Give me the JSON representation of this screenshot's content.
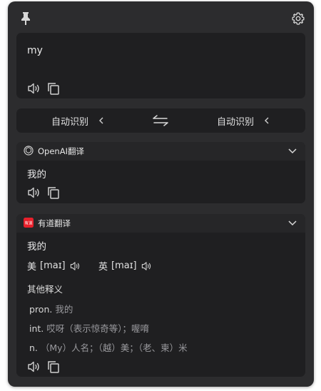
{
  "input": {
    "text": "my"
  },
  "languages": {
    "source": "自动识别",
    "target": "自动识别"
  },
  "openai": {
    "service_name": "OpenAI翻译",
    "result": "我的"
  },
  "youdao": {
    "service_name": "有道翻译",
    "logo_text": "有道",
    "result": "我的",
    "phonetics": [
      {
        "region": "美",
        "ipa": "[maɪ]"
      },
      {
        "region": "英",
        "ipa": "[maɪ]"
      }
    ],
    "other_label": "其他释义",
    "definitions": [
      {
        "pos": "pron.",
        "meaning": "我的"
      },
      {
        "pos": "int.",
        "meaning": "哎呀（表示惊奇等）；喔唷"
      },
      {
        "pos": "n.",
        "meaning": "（My）人名；（越）美；（老、柬）米"
      }
    ]
  },
  "colors": {
    "window": "#2c2c2e",
    "panel": "#1f1f21",
    "youdao_red": "#e8202b"
  }
}
